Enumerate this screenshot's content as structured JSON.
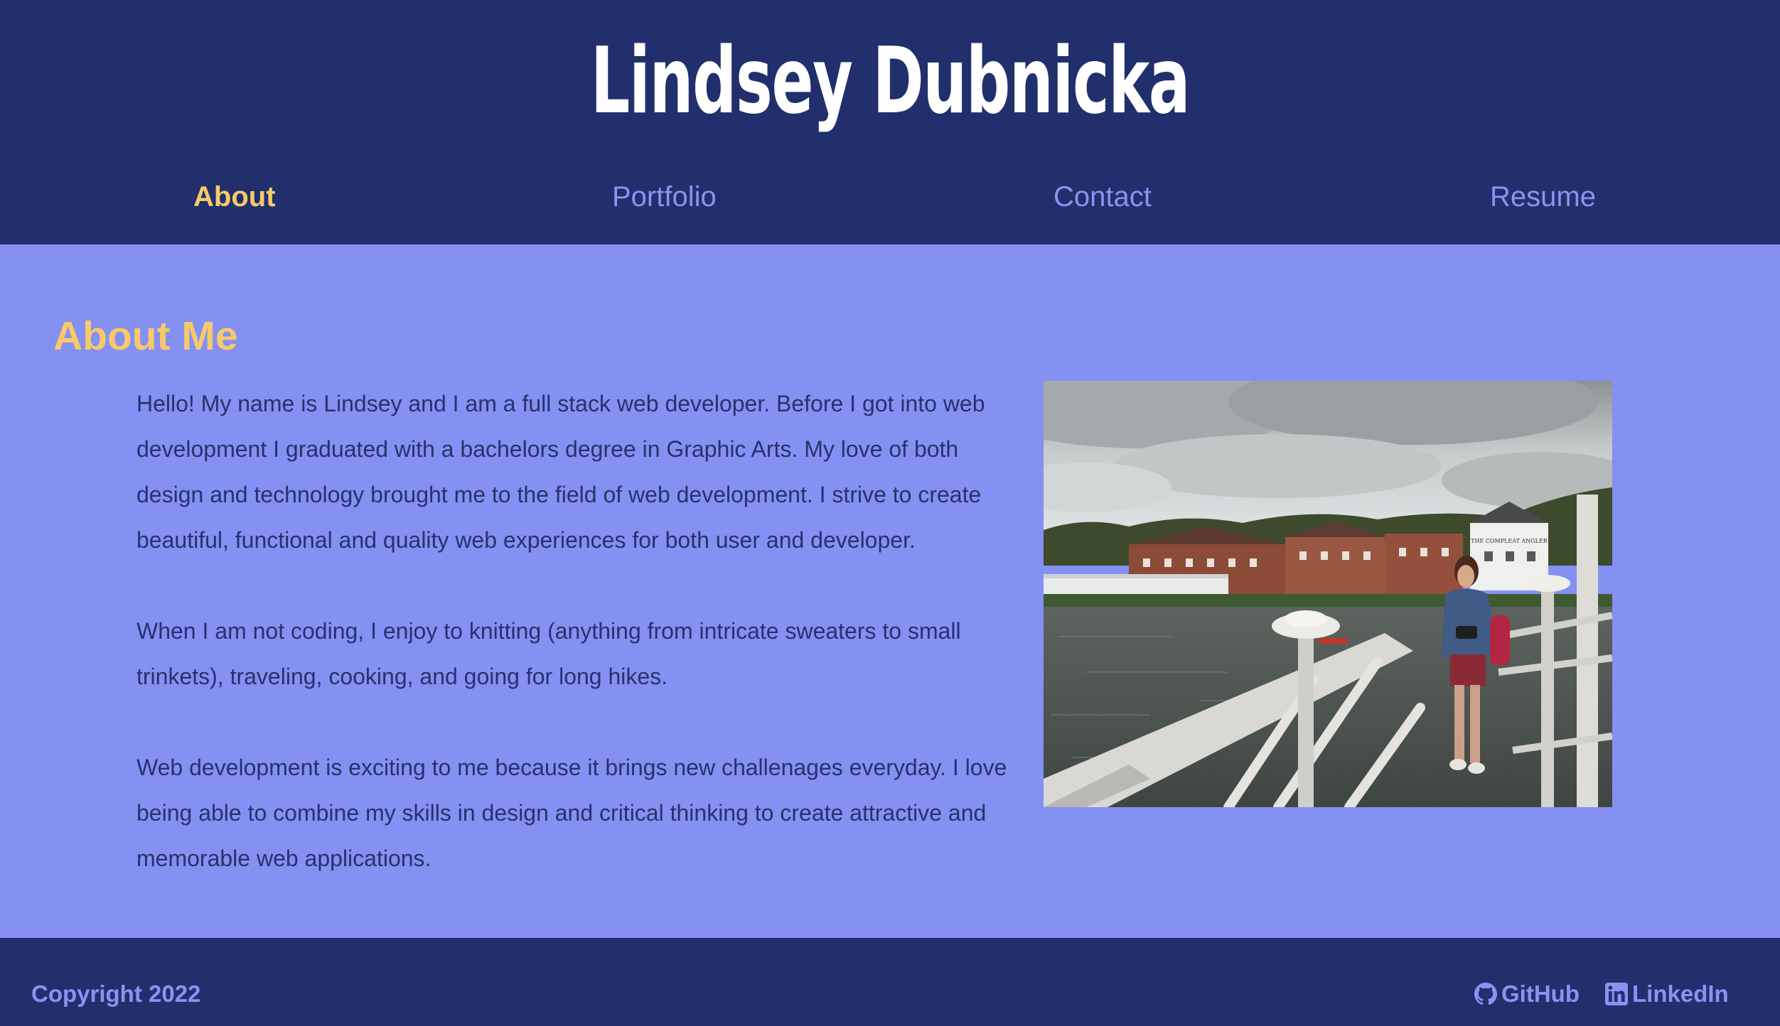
{
  "header": {
    "title": "Lindsey Dubnicka"
  },
  "nav": {
    "items": [
      {
        "label": "About",
        "active": true
      },
      {
        "label": "Portfolio",
        "active": false
      },
      {
        "label": "Contact",
        "active": false
      },
      {
        "label": "Resume",
        "active": false
      }
    ]
  },
  "about": {
    "heading": "About Me",
    "paragraphs": [
      "Hello! My name is Lindsey and I am a full stack web developer. Before I got into web development I graduated with a bachelors degree in Graphic Arts. My love of both design and technology brought me to the field of web development. I strive to create beautiful, functional and quality web experiences for both user and developer.",
      "When I am not coding, I enjoy to knitting (anything from intricate sweaters to small trinkets), traveling, cooking, and going for long hikes.",
      "Web development is exciting to me because it brings new challenages everyday. I love being able to combine my skills in design and critical thinking to create attractive and memorable web applications."
    ],
    "photo_sign_text": "THE COMPLEAT ANGLER"
  },
  "footer": {
    "copyright": "Copyright 2022",
    "links": [
      {
        "label": "GitHub",
        "icon": "github-icon"
      },
      {
        "label": "LinkedIn",
        "icon": "linkedin-icon"
      }
    ]
  },
  "colors": {
    "header_bg": "#21306c",
    "main_bg": "#8490f2",
    "accent": "#f7c96b",
    "nav_text": "#8794f2",
    "body_text": "#24336d"
  }
}
